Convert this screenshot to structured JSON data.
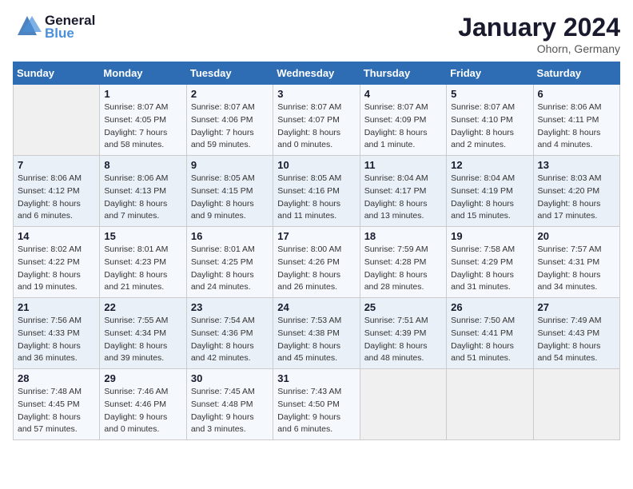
{
  "logo": {
    "line1": "General",
    "line2": "Blue"
  },
  "title": "January 2024",
  "location": "Ohorn, Germany",
  "days_of_week": [
    "Sunday",
    "Monday",
    "Tuesday",
    "Wednesday",
    "Thursday",
    "Friday",
    "Saturday"
  ],
  "weeks": [
    [
      {
        "day": "",
        "info": ""
      },
      {
        "day": "1",
        "info": "Sunrise: 8:07 AM\nSunset: 4:05 PM\nDaylight: 7 hours\nand 58 minutes."
      },
      {
        "day": "2",
        "info": "Sunrise: 8:07 AM\nSunset: 4:06 PM\nDaylight: 7 hours\nand 59 minutes."
      },
      {
        "day": "3",
        "info": "Sunrise: 8:07 AM\nSunset: 4:07 PM\nDaylight: 8 hours\nand 0 minutes."
      },
      {
        "day": "4",
        "info": "Sunrise: 8:07 AM\nSunset: 4:09 PM\nDaylight: 8 hours\nand 1 minute."
      },
      {
        "day": "5",
        "info": "Sunrise: 8:07 AM\nSunset: 4:10 PM\nDaylight: 8 hours\nand 2 minutes."
      },
      {
        "day": "6",
        "info": "Sunrise: 8:06 AM\nSunset: 4:11 PM\nDaylight: 8 hours\nand 4 minutes."
      }
    ],
    [
      {
        "day": "7",
        "info": "Sunrise: 8:06 AM\nSunset: 4:12 PM\nDaylight: 8 hours\nand 6 minutes."
      },
      {
        "day": "8",
        "info": "Sunrise: 8:06 AM\nSunset: 4:13 PM\nDaylight: 8 hours\nand 7 minutes."
      },
      {
        "day": "9",
        "info": "Sunrise: 8:05 AM\nSunset: 4:15 PM\nDaylight: 8 hours\nand 9 minutes."
      },
      {
        "day": "10",
        "info": "Sunrise: 8:05 AM\nSunset: 4:16 PM\nDaylight: 8 hours\nand 11 minutes."
      },
      {
        "day": "11",
        "info": "Sunrise: 8:04 AM\nSunset: 4:17 PM\nDaylight: 8 hours\nand 13 minutes."
      },
      {
        "day": "12",
        "info": "Sunrise: 8:04 AM\nSunset: 4:19 PM\nDaylight: 8 hours\nand 15 minutes."
      },
      {
        "day": "13",
        "info": "Sunrise: 8:03 AM\nSunset: 4:20 PM\nDaylight: 8 hours\nand 17 minutes."
      }
    ],
    [
      {
        "day": "14",
        "info": "Sunrise: 8:02 AM\nSunset: 4:22 PM\nDaylight: 8 hours\nand 19 minutes."
      },
      {
        "day": "15",
        "info": "Sunrise: 8:01 AM\nSunset: 4:23 PM\nDaylight: 8 hours\nand 21 minutes."
      },
      {
        "day": "16",
        "info": "Sunrise: 8:01 AM\nSunset: 4:25 PM\nDaylight: 8 hours\nand 24 minutes."
      },
      {
        "day": "17",
        "info": "Sunrise: 8:00 AM\nSunset: 4:26 PM\nDaylight: 8 hours\nand 26 minutes."
      },
      {
        "day": "18",
        "info": "Sunrise: 7:59 AM\nSunset: 4:28 PM\nDaylight: 8 hours\nand 28 minutes."
      },
      {
        "day": "19",
        "info": "Sunrise: 7:58 AM\nSunset: 4:29 PM\nDaylight: 8 hours\nand 31 minutes."
      },
      {
        "day": "20",
        "info": "Sunrise: 7:57 AM\nSunset: 4:31 PM\nDaylight: 8 hours\nand 34 minutes."
      }
    ],
    [
      {
        "day": "21",
        "info": "Sunrise: 7:56 AM\nSunset: 4:33 PM\nDaylight: 8 hours\nand 36 minutes."
      },
      {
        "day": "22",
        "info": "Sunrise: 7:55 AM\nSunset: 4:34 PM\nDaylight: 8 hours\nand 39 minutes."
      },
      {
        "day": "23",
        "info": "Sunrise: 7:54 AM\nSunset: 4:36 PM\nDaylight: 8 hours\nand 42 minutes."
      },
      {
        "day": "24",
        "info": "Sunrise: 7:53 AM\nSunset: 4:38 PM\nDaylight: 8 hours\nand 45 minutes."
      },
      {
        "day": "25",
        "info": "Sunrise: 7:51 AM\nSunset: 4:39 PM\nDaylight: 8 hours\nand 48 minutes."
      },
      {
        "day": "26",
        "info": "Sunrise: 7:50 AM\nSunset: 4:41 PM\nDaylight: 8 hours\nand 51 minutes."
      },
      {
        "day": "27",
        "info": "Sunrise: 7:49 AM\nSunset: 4:43 PM\nDaylight: 8 hours\nand 54 minutes."
      }
    ],
    [
      {
        "day": "28",
        "info": "Sunrise: 7:48 AM\nSunset: 4:45 PM\nDaylight: 8 hours\nand 57 minutes."
      },
      {
        "day": "29",
        "info": "Sunrise: 7:46 AM\nSunset: 4:46 PM\nDaylight: 9 hours\nand 0 minutes."
      },
      {
        "day": "30",
        "info": "Sunrise: 7:45 AM\nSunset: 4:48 PM\nDaylight: 9 hours\nand 3 minutes."
      },
      {
        "day": "31",
        "info": "Sunrise: 7:43 AM\nSunset: 4:50 PM\nDaylight: 9 hours\nand 6 minutes."
      },
      {
        "day": "",
        "info": ""
      },
      {
        "day": "",
        "info": ""
      },
      {
        "day": "",
        "info": ""
      }
    ]
  ]
}
